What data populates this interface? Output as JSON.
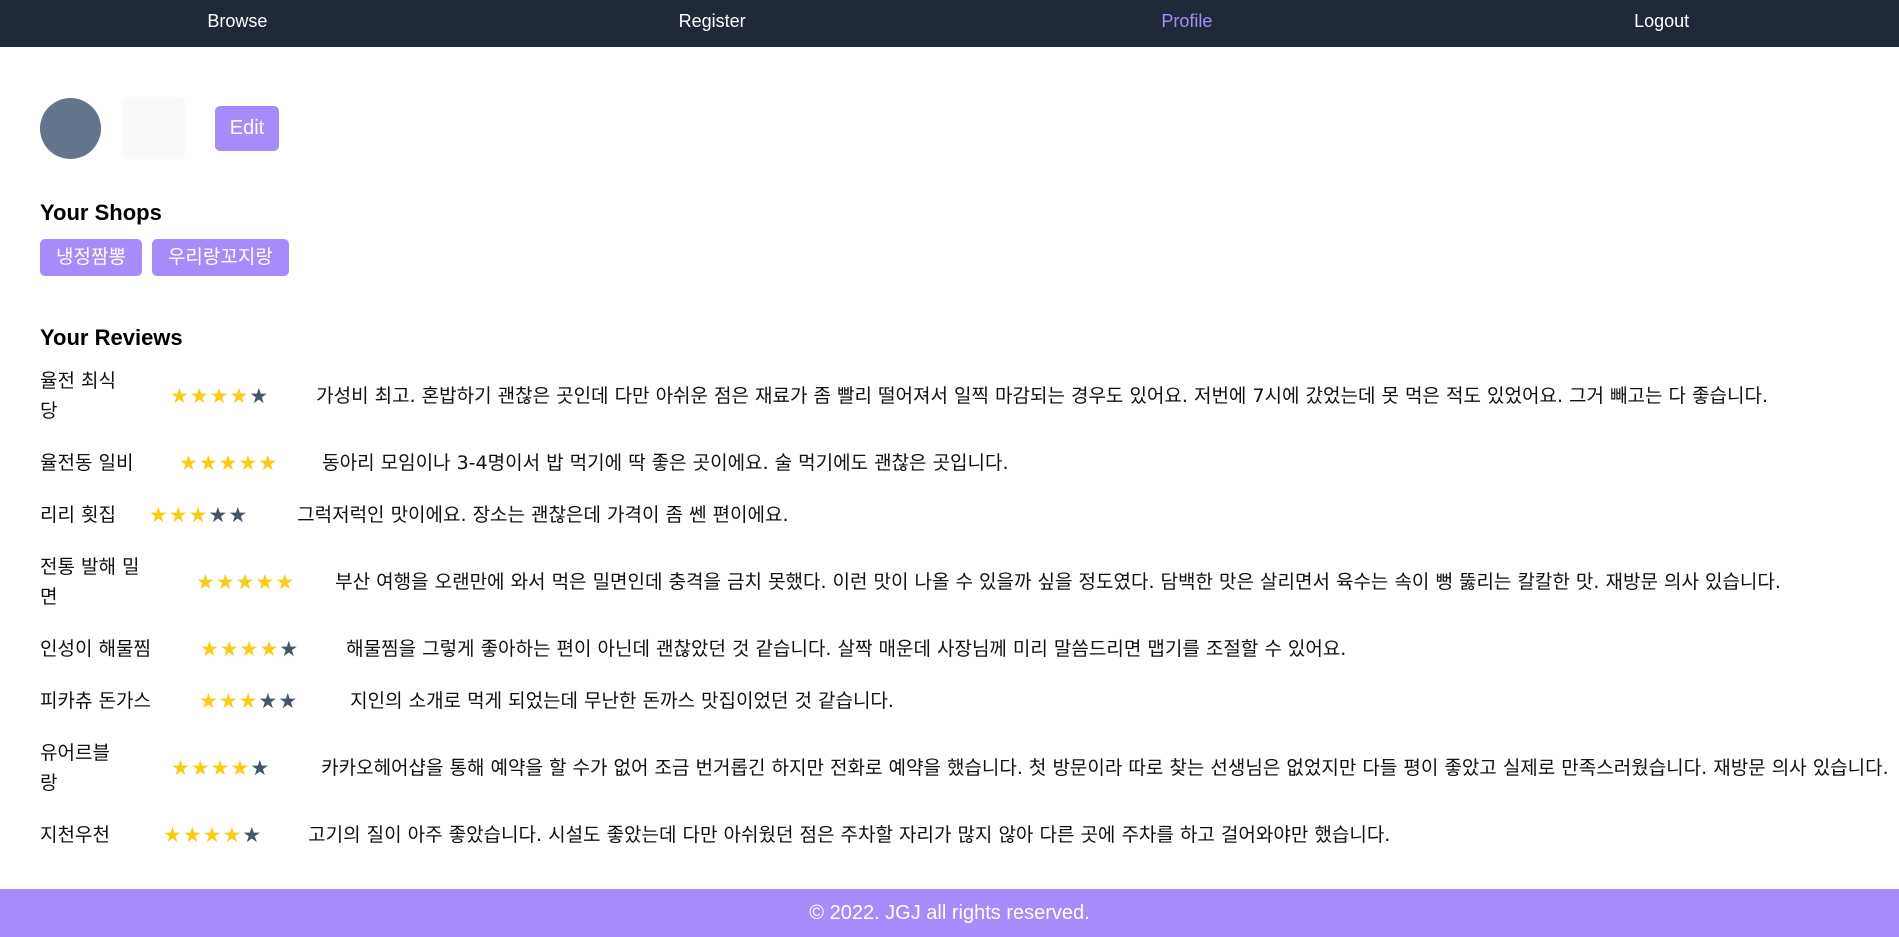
{
  "nav": {
    "browse": "Browse",
    "register": "Register",
    "profile": "Profile",
    "logout": "Logout",
    "active": "profile",
    "active_color": "#a78bfa"
  },
  "profile": {
    "edit_label": "Edit",
    "avatar_color": "#64748b"
  },
  "shops": {
    "title": "Your Shops",
    "items": [
      "냉정짬뽕",
      "우리랑꼬지랑"
    ]
  },
  "reviews": {
    "title": "Your Reviews",
    "star_color": "#facc15",
    "items": [
      {
        "shop": "율전 최식\n당",
        "rating": 4,
        "text": "가성비 최고. 혼밥하기 괜찮은 곳인데 다만 아쉬운 점은 재료가 좀 빨리 떨어져서 일찍 마감되는 경우도 있어요. 저번에 7시에 갔었는데 못 먹은 적도 있었어요. 그거 빼고는 다 좋습니다."
      },
      {
        "shop": "율전동 일비",
        "rating": 5,
        "text": "동아리 모임이나 3-4명이서 밥 먹기에 딱 좋은 곳이에요. 술 먹기에도 괜찮은 곳입니다."
      },
      {
        "shop": "리리 횟집",
        "rating": 3,
        "text": "그럭저럭인 맛이에요. 장소는 괜찮은데 가격이 좀 쎈 편이에요."
      },
      {
        "shop": "전통 발해 밀\n면",
        "rating": 5,
        "text": "부산 여행을 오랜만에 와서 먹은 밀면인데 충격을 금치 못했다. 이런 맛이 나올 수 있을까 싶을 정도였다. 담백한 맛은 살리면서 육수는 속이 뻥 뚫리는 칼칼한 맛. 재방문 의사 있습니다."
      },
      {
        "shop": "인성이 해물찜",
        "rating": 4,
        "text": "해물찜을 그렇게 좋아하는 편이 아닌데 괜찮았던 것 같습니다. 살짝 매운데 사장님께 미리 말씀드리면 맵기를 조절할 수 있어요."
      },
      {
        "shop": "피카츄 돈가스",
        "rating": 3,
        "text": "지인의 소개로 먹게 되었는데 무난한 돈까스 맛집이었던 것 같습니다."
      },
      {
        "shop": "유어르블\n랑",
        "rating": 4,
        "text": "카카오헤어샵을 통해 예약을 할 수가 없어 조금 번거롭긴 하지만 전화로 예약을 했습니다. 첫 방문이라 따로 찾는 선생님은 없었지만 다들 평이 좋았고 실제로 만족스러웠습니다. 재방문 의사 있습니다."
      },
      {
        "shop": "지천우천",
        "rating": 4,
        "text": "고기의 질이 아주 좋았습니다. 시설도 좋았는데 다만 아쉬웠던 점은 주차할 자리가 많지 않아 다른 곳에 주차를 하고 걸어와야만 했습니다."
      }
    ]
  },
  "footer": {
    "text": "© 2022. JGJ all rights reserved."
  }
}
